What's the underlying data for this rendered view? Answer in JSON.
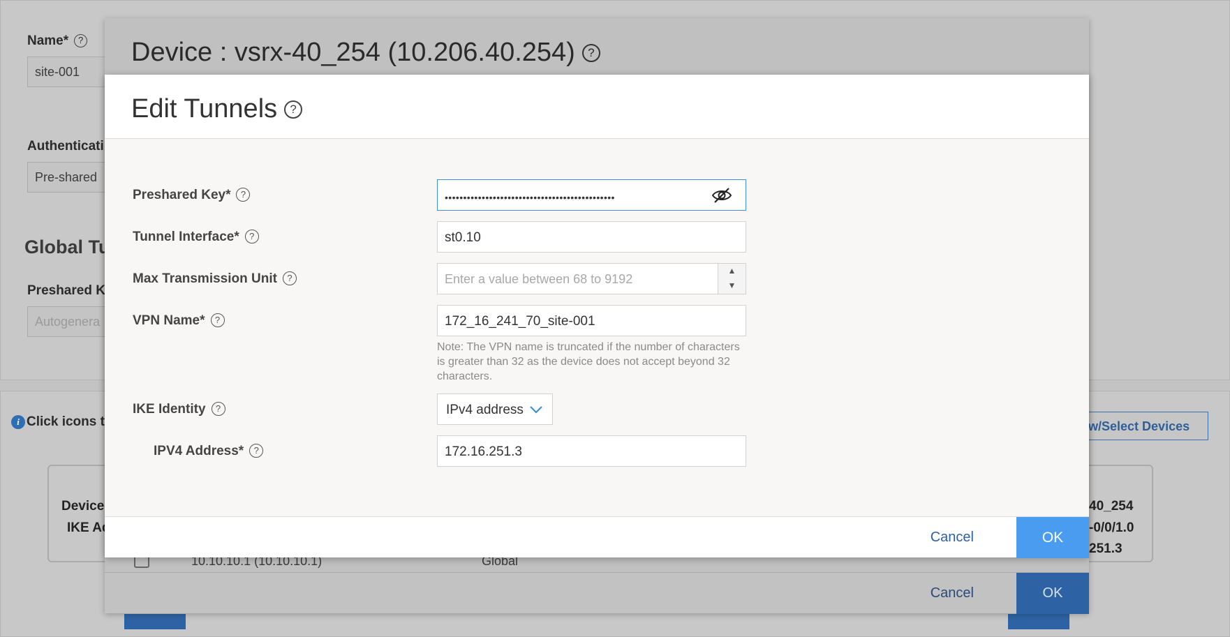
{
  "background": {
    "name_label": "Name*",
    "name_value": "site-001",
    "auth_label": "Authenticati",
    "auth_value": "Pre-shared",
    "global_heading": "Global Tu",
    "preshared_label": "Preshared Ke",
    "preshared_placeholder": "Autogenera",
    "info_text": "Click icons to",
    "view_select_button": "ew/Select Devices",
    "device_label": "Device",
    "ike_label": "IKE Ad",
    "right_values": [
      "40_254",
      "-0/0/1.0",
      "251.3"
    ],
    "table_row": {
      "address": "10.10.10.1 (10.10.10.1)",
      "scope": "Global"
    }
  },
  "outer_dialog": {
    "title": "Device : vsrx-40_254 (10.206.40.254)",
    "help_icon": "?",
    "cancel_label": "Cancel",
    "ok_label": "OK"
  },
  "modal": {
    "title": "Edit Tunnels",
    "help_icon": "?",
    "fields": {
      "preshared_key": {
        "label": "Preshared Key*",
        "value": "••••••••••••••••••••••••••••••••••••••••••••••"
      },
      "tunnel_interface": {
        "label": "Tunnel Interface*",
        "value": "st0.10"
      },
      "mtu": {
        "label": "Max Transmission Unit",
        "placeholder": "Enter a value between 68 to 9192"
      },
      "vpn_name": {
        "label": "VPN Name*",
        "value": "172_16_241_70_site-001",
        "note": "Note: The VPN name is truncated if the number of characters is greater than 32 as the device does not accept beyond 32 characters."
      },
      "ike_identity": {
        "label": "IKE Identity",
        "value": "IPv4 address"
      },
      "ipv4_address": {
        "label": "IPV4 Address*",
        "value": "172.16.251.3"
      }
    },
    "cancel_label": "Cancel",
    "ok_label": "OK"
  },
  "colors": {
    "primary": "#4a9cf0",
    "link": "#2e5fa8",
    "focus_border": "#3d8ee0"
  },
  "icons": [
    "help-icon",
    "eye-slash-icon",
    "stepper-up-icon",
    "stepper-down-icon",
    "chevron-down-icon",
    "info-icon"
  ]
}
